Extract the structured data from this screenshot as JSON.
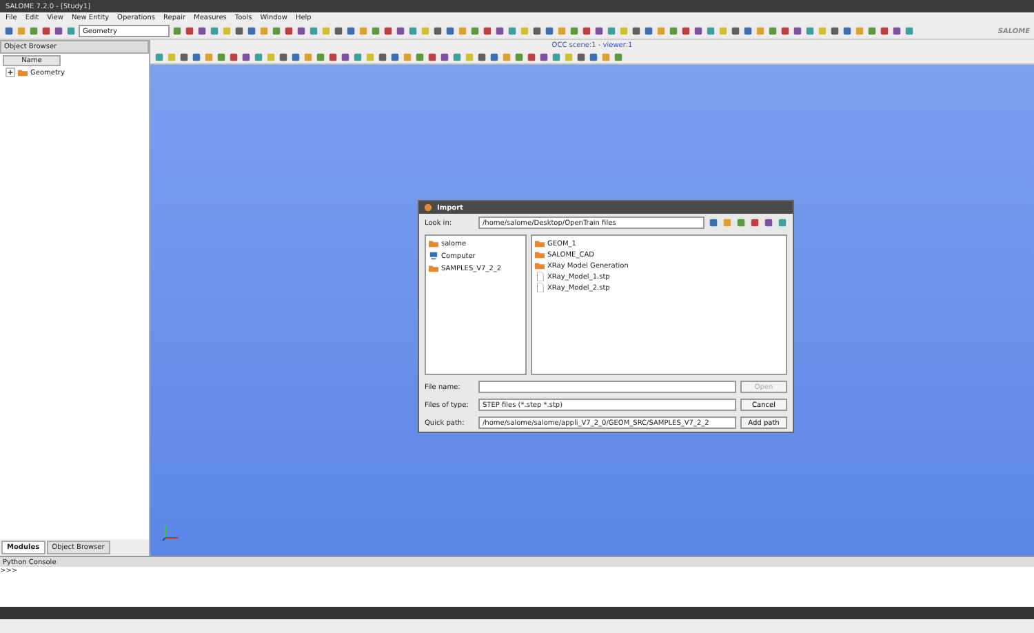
{
  "window": {
    "title": "SALOME 7.2.0 - [Study1]",
    "brand": "SALOME"
  },
  "menu": [
    "File",
    "Edit",
    "View",
    "New Entity",
    "Operations",
    "Repair",
    "Measures",
    "Tools",
    "Window",
    "Help"
  ],
  "module_selector": {
    "value": "Geometry"
  },
  "object_browser": {
    "title": "Object Browser",
    "column": "Name",
    "tree": [
      {
        "label": "Geometry",
        "expanded": false
      }
    ]
  },
  "left_tabs": [
    {
      "label": "Modules",
      "selected": true
    },
    {
      "label": "Object Browser",
      "selected": false
    }
  ],
  "viewer": {
    "title": "OCC scene:1 - viewer:1"
  },
  "dialog": {
    "title": "Import",
    "look_in_label": "Look in:",
    "look_in": "/home/salome/Desktop/OpenTrain files",
    "places": [
      {
        "label": "salome",
        "kind": "folder"
      },
      {
        "label": "Computer",
        "kind": "computer"
      },
      {
        "label": "SAMPLES_V7_2_2",
        "kind": "folder"
      }
    ],
    "files": [
      {
        "label": "GEOM_1",
        "kind": "folder"
      },
      {
        "label": "SALOME_CAD",
        "kind": "folder"
      },
      {
        "label": "XRay Model Generation",
        "kind": "folder"
      },
      {
        "label": "XRay_Model_1.stp",
        "kind": "file"
      },
      {
        "label": "XRay_Model_2.stp",
        "kind": "file"
      }
    ],
    "file_name_label": "File name:",
    "type_label": "Files of type:",
    "type": "STEP files (*.step *.stp)",
    "quick_label": "Quick path:",
    "quick": "/home/salome/salome/appli_V7_2_0/GEOM_SRC/SAMPLES_V7_2_2",
    "buttons": [
      {
        "label": "Open",
        "disabled": true
      },
      {
        "label": "Cancel",
        "disabled": false
      },
      {
        "label": "Add path",
        "disabled": false
      }
    ]
  },
  "console": {
    "title": "Python Console",
    "prompt": ">>>"
  }
}
